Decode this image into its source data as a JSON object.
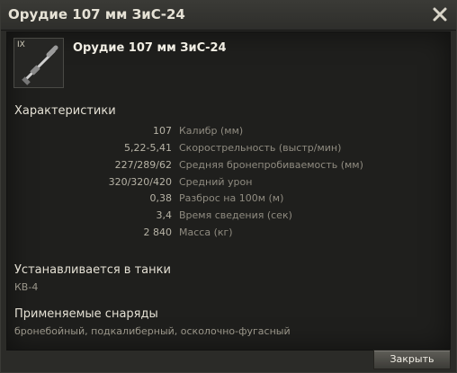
{
  "window": {
    "title": "Орудие 107 мм ЗиС-24",
    "close_icon": "close-x-icon"
  },
  "item": {
    "tier": "IX",
    "name": "Орудие 107 мм ЗиС-24",
    "icon": "gun-icon"
  },
  "characteristics": {
    "title": "Характеристики",
    "rows": [
      {
        "value": "107",
        "label": "Калибр (мм)"
      },
      {
        "value": "5,22-5,41",
        "label": "Скорострельность (выстр/мин)"
      },
      {
        "value": "227/289/62",
        "label": "Средняя бронепробиваемость (мм)"
      },
      {
        "value": "320/320/420",
        "label": "Средний урон"
      },
      {
        "value": "0,38",
        "label": "Разброс на 100м (м)"
      },
      {
        "value": "3,4",
        "label": "Время сведения (сек)"
      },
      {
        "value": "2 840",
        "label": "Масса (кг)"
      }
    ]
  },
  "installed": {
    "title": "Устанавливается в танки",
    "value": "КВ-4"
  },
  "shells": {
    "title": "Применяемые снаряды",
    "value": "бронебойный, подкалиберный, осколочно-фугасный"
  },
  "footer": {
    "close_label": "Закрыть"
  }
}
